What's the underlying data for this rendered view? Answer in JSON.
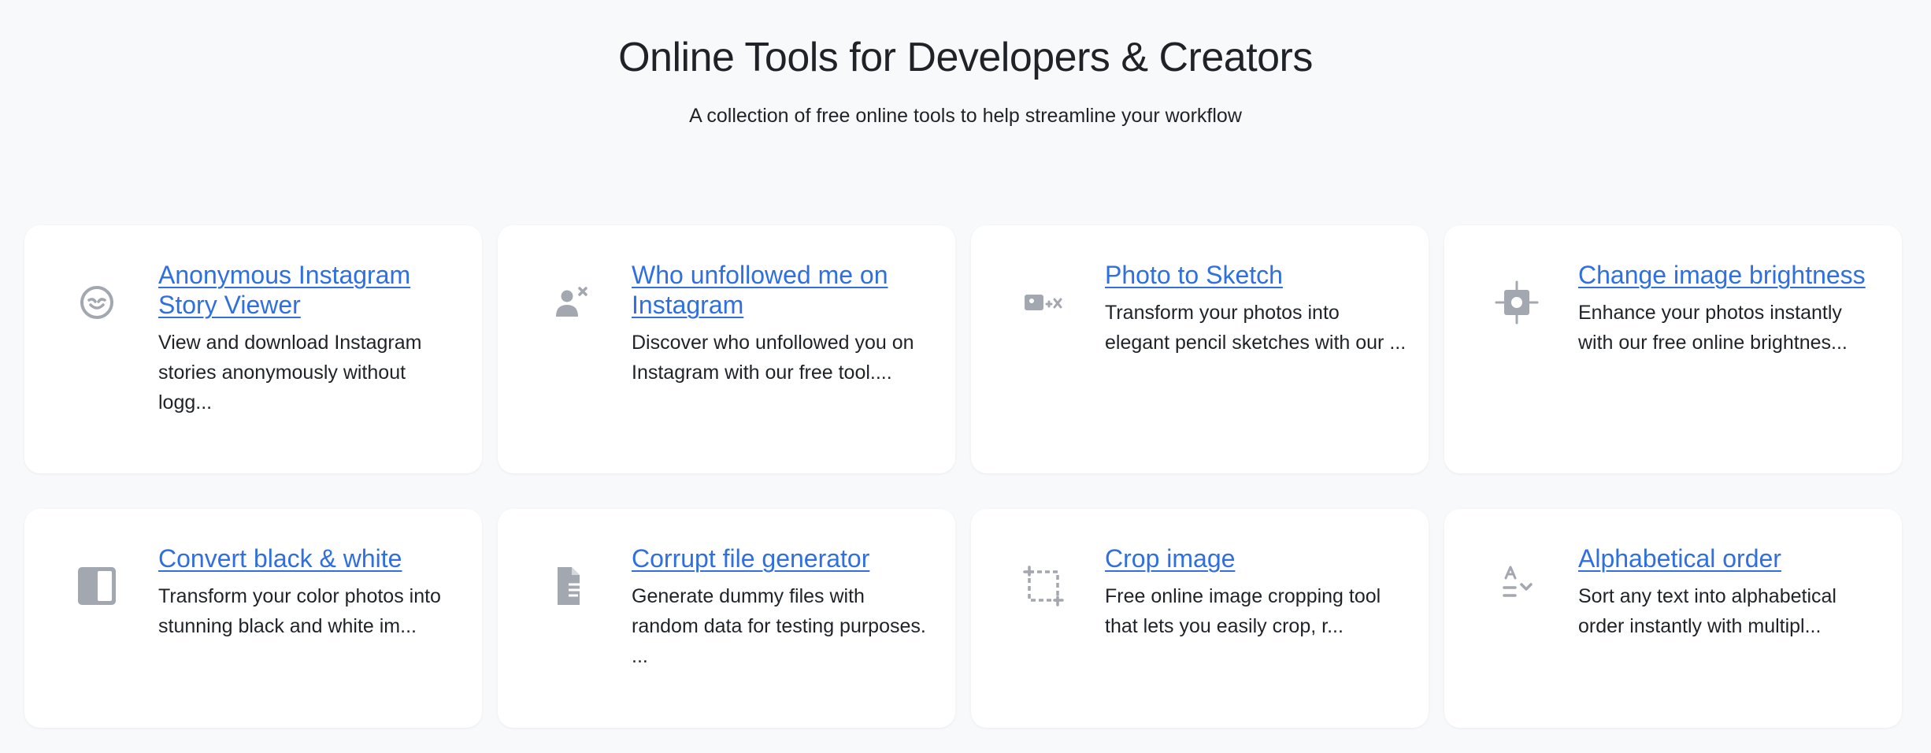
{
  "header": {
    "title": "Online Tools for Developers & Creators",
    "subtitle": "A collection of free online tools to help streamline your workflow"
  },
  "tools": [
    {
      "title": "Anonymous Instagram Story Viewer",
      "description": "View and download Instagram stories anonymously without logg...",
      "icon": "anonymous-face-icon"
    },
    {
      "title": "Who unfollowed me on Instagram",
      "description": "Discover who unfollowed you on Instagram with our free tool....",
      "icon": "user-remove-icon"
    },
    {
      "title": "Photo to Sketch",
      "description": "Transform your photos into elegant pencil sketches with our ...",
      "icon": "photo-transform-icon"
    },
    {
      "title": "Change image brightness",
      "description": "Enhance your photos instantly with our free online brightnes...",
      "icon": "brightness-icon"
    },
    {
      "title": "Convert black & white",
      "description": "Transform your color photos into stunning black and white im...",
      "icon": "contrast-icon"
    },
    {
      "title": "Corrupt file generator",
      "description": "Generate dummy files with random data for testing purposes. ...",
      "icon": "file-icon"
    },
    {
      "title": "Crop image",
      "description": "Free online image cropping tool that lets you easily crop, r...",
      "icon": "crop-icon"
    },
    {
      "title": "Alphabetical order",
      "description": "Sort any text into alphabetical order instantly with multipl...",
      "icon": "sort-alpha-icon"
    }
  ],
  "colors": {
    "background": "#f8f9fb",
    "card": "#ffffff",
    "link": "#2f6fe0",
    "icon": "#a3a8b0",
    "text": "#1f2328"
  }
}
